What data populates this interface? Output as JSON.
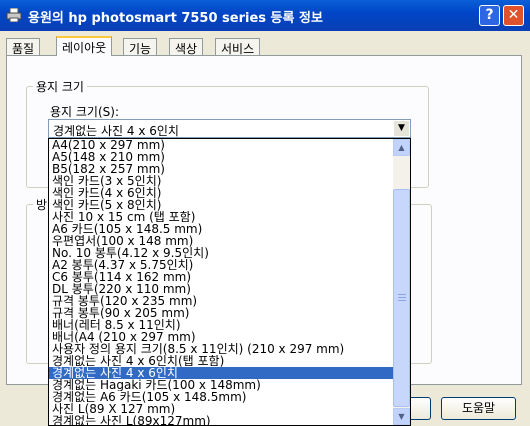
{
  "window": {
    "title": "용원의 hp photosmart 7550 series 등록 정보",
    "help_label": "?",
    "close_label": "✕"
  },
  "tabs": [
    {
      "label": "품질"
    },
    {
      "label": "레이아웃"
    },
    {
      "label": "기능"
    },
    {
      "label": "색상"
    },
    {
      "label": "서비스"
    }
  ],
  "paper_group": {
    "title": "용지 크기",
    "field_label": "용지 크기(S):",
    "selected_value": "경계없는 사진 4 x 6인치"
  },
  "second_group": {
    "title_visible": "방"
  },
  "paper_sizes": [
    "A4(210 x 297 mm)",
    "A5(148 x 210 mm)",
    "B5(182 x 257 mm)",
    "색인 카드(3 x 5인치)",
    "색인 카드(4 x 6인치)",
    "색인 카드(5 x 8인치)",
    "사진 10 x 15 cm (탭 포함)",
    "A6 카드(105 x 148.5 mm)",
    "우편엽서(100 x 148 mm)",
    "No. 10 봉투(4.12 x 9.5인치)",
    "A2 봉투(4.37 x 5.75인치)",
    "C6 봉투(114 x 162 mm)",
    "DL 봉투(220 x 110 mm)",
    "규격 봉투(120 x 235 mm)",
    "규격 봉투(90 x 205 mm)",
    "배너(레터 8.5 x 11인치)",
    "배너(A4 (210 x 297 mm)",
    "사용자 정의 용지 크기(8.5 x 11인치) (210 x 297 mm)",
    "경계없는 사진 4 x 6인치(탭 포함)",
    "경계없는 사진 4 x 6인치",
    "경계없는 Hagaki 카드(100 x 148mm)",
    "경계없는 A6 카드(105 x 148.5mm)",
    "사진 L(89 X 127 mm)",
    "경계없는 사진 L(89x127mm)"
  ],
  "selected_index": 19,
  "buttons": {
    "help": "도움말"
  },
  "icons": {
    "app": "printer-icon",
    "combo": "chevron-down-icon",
    "scroll_up": "scroll-up-arrow-icon",
    "scroll_down": "scroll-down-arrow-icon"
  }
}
